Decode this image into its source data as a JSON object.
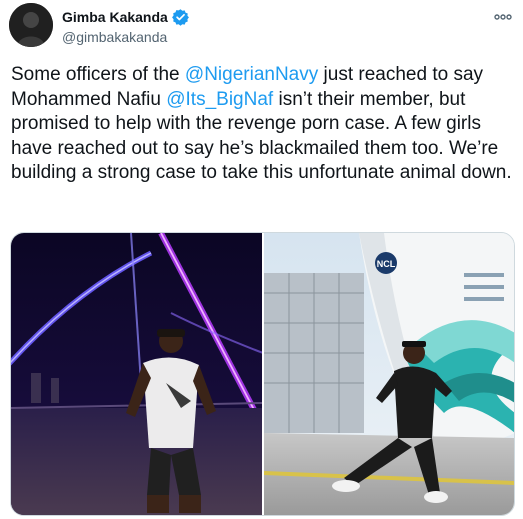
{
  "tweet": {
    "author": {
      "display_name": "Gimba Kakanda",
      "handle": "@gimbakakanda",
      "verified": true
    },
    "text_parts": {
      "p1": "Some officers of the ",
      "mention1": "@NigerianNavy",
      "p2": " just reached to say Mohammed Nafiu ",
      "mention2": "@Its_BigNaf",
      "p3": " isn’t their member, but promised to help with the revenge porn case. A few girls have reached out to say he’s blackmailed them too. We’re building a strong case to take this unfortunate animal down."
    },
    "media": [
      {
        "name": "photo-night",
        "icon": "photo"
      },
      {
        "name": "photo-ship",
        "icon": "photo",
        "ship_logo_text": "NCL"
      }
    ]
  },
  "colors": {
    "accent": "#1d9bf0",
    "text": "#0f1419",
    "secondary": "#536471"
  }
}
